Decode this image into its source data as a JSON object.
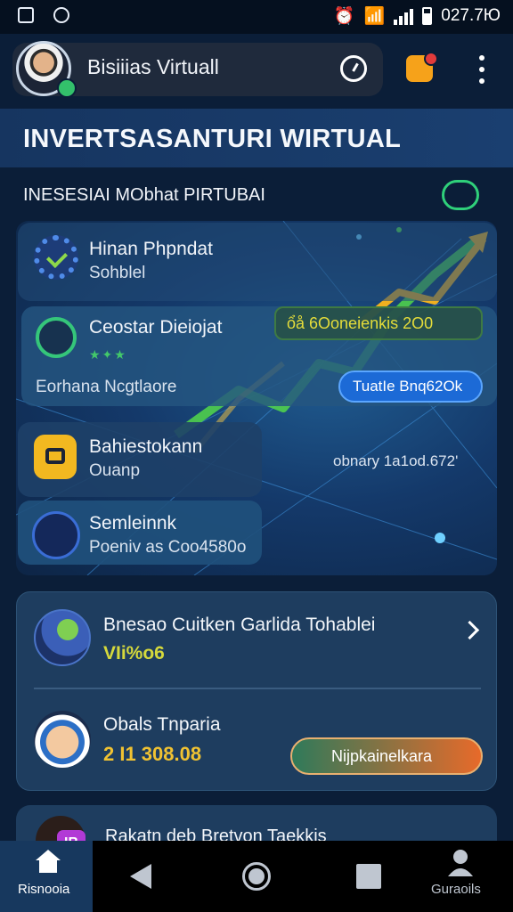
{
  "status_bar": {
    "time": "027.7Ю",
    "left_icons": [
      "notification-box-icon",
      "sync-icon"
    ],
    "right_icons": [
      "alarm-icon",
      "wifi-icon",
      "signal-icon",
      "battery-icon"
    ]
  },
  "header": {
    "title": "Bisiiias Virtuall",
    "buttons": [
      "clock-icon",
      "notification-icon",
      "more-vert-icon"
    ]
  },
  "banner": {
    "title": "INVERTSASANTURI WIRTUAL"
  },
  "section": {
    "title": "INESESIAI MObhat PIRTUBAI",
    "icon": "clock-arrow-icon"
  },
  "cards": {
    "card1": {
      "title": "Hinan Phpndat",
      "subtitle": "Sohblel",
      "icon": "gear-check-icon"
    },
    "card2": {
      "title": "Ceostar Dieiojat",
      "subtitle": "Eorhana Ncgtlaore",
      "icon": "chat-icon",
      "badge": "ổå 6Ooneienkis 2O0",
      "button": "TuatIe Bnq62Ok"
    },
    "card3": {
      "title": "Bahiestokann",
      "subtitle": "Ouanp",
      "icon": "box-icon",
      "metric": "obnary 1a1od.672'"
    },
    "card4": {
      "title": "Semleinnk",
      "subtitle": "Poeniv as Coo4580o",
      "icon": "person-icon"
    }
  },
  "list": {
    "item1": {
      "title": "Bnesao Cuitken Garlida Tohablei",
      "value": "VIi%o6",
      "icon": "investment-icon"
    },
    "item2": {
      "title": "Obals Tnparia",
      "value": "2 I1  308.08",
      "button": "Nijpkainelkara",
      "icon": "avatar-icon"
    },
    "item3": {
      "title": "Rakatn deb Bretvon Taekkis",
      "badge": "IB"
    }
  },
  "bottom_nav": {
    "home_label": "Risnooia",
    "profile_label": "Guraoils"
  },
  "colors": {
    "background": "#0b1e38",
    "accent_green": "#2fd07a",
    "accent_blue": "#1c6ad6",
    "accent_yellow": "#e4dc3a",
    "accent_orange": "#e76a2a"
  }
}
